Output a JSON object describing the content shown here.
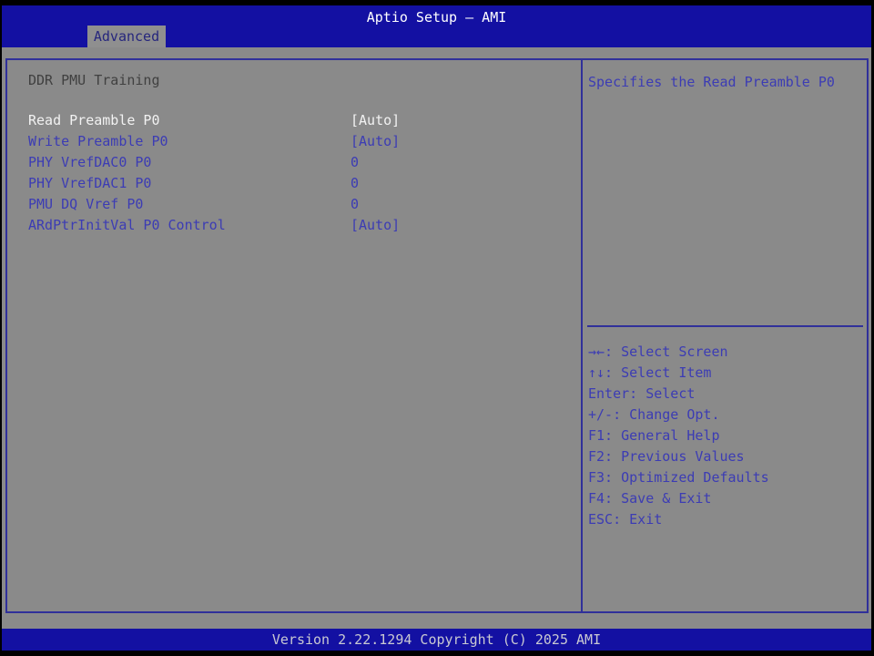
{
  "header": {
    "title": "Aptio Setup – AMI",
    "tab": "Advanced"
  },
  "left_panel": {
    "section_title": "DDR PMU Training",
    "items": [
      {
        "label": "Read Preamble P0",
        "value": "[Auto]",
        "selected": true
      },
      {
        "label": "Write Preamble P0",
        "value": "[Auto]",
        "selected": false
      },
      {
        "label": "PHY VrefDAC0 P0",
        "value": "0",
        "selected": false
      },
      {
        "label": "PHY VrefDAC1 P0",
        "value": "0",
        "selected": false
      },
      {
        "label": "PMU DQ Vref P0",
        "value": "0",
        "selected": false
      },
      {
        "label": "ARdPtrInitVal P0 Control",
        "value": "[Auto]",
        "selected": false
      }
    ]
  },
  "help_panel": {
    "description": "Specifies the Read Preamble P0",
    "keys": [
      "→←: Select Screen",
      "↑↓: Select Item",
      "Enter: Select",
      "+/-: Change Opt.",
      "F1: General Help",
      "F2: Previous Values",
      "F3: Optimized Defaults",
      "F4: Save & Exit",
      "ESC: Exit"
    ]
  },
  "footer": {
    "version_text": "Version 2.22.1294 Copyright (C) 2025 AMI"
  },
  "colors": {
    "header_blue": "#1310a2",
    "body_gray": "#8a8a8a",
    "panel_border_navy": "#30309a",
    "item_text_blue": "#3c3cb4",
    "selected_text_white": "#f2f2f2",
    "section_text_gray": "#404040",
    "version_text_gray": "#c9c9d2"
  }
}
